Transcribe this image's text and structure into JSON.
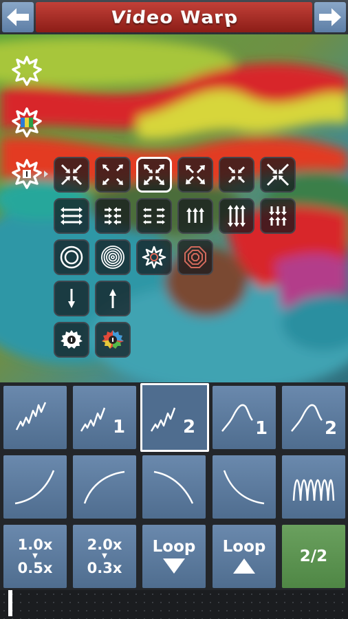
{
  "header": {
    "title": "Video Warp",
    "back_icon": "arrow-left-icon",
    "forward_icon": "arrow-right-icon"
  },
  "side_tools": [
    {
      "name": "warp-mode-icon",
      "icon": "star-burst-icon"
    },
    {
      "name": "color-mode-icon",
      "icon": "star-burst-color-icon"
    },
    {
      "name": "effect-menu-icon",
      "icon": "star-burst-info-icon"
    }
  ],
  "effects_menu": {
    "rows": [
      [
        "pinch-in-icon",
        "expand-corners-icon",
        "pinch-selected-icon",
        "stretch-out-icon",
        "pinch-small-icon",
        "shrink-center-icon"
      ],
      [
        "horizontal-swipe-icon",
        "horizontal-push-icon",
        "horizontal-split-icon",
        "vertical-swipe-icon",
        "vertical-push-icon",
        "vertical-split-icon"
      ],
      [
        "ripple-ring-icon",
        "ripple-many-icon",
        "burst-star-icon",
        "ripple-octagon-icon"
      ],
      [
        "arrow-down-icon",
        "arrow-up-icon"
      ],
      [
        "settings-gear-icon",
        "color-gear-icon"
      ]
    ],
    "selected": "pinch-selected-icon"
  },
  "curves": {
    "row1": [
      {
        "name": "zigzag-curve",
        "label": ""
      },
      {
        "name": "zigzag-curve-1",
        "label": "1"
      },
      {
        "name": "zigzag-curve-2",
        "label": "2",
        "selected": true
      },
      {
        "name": "smooth-curve-1",
        "label": "1"
      },
      {
        "name": "smooth-curve-2",
        "label": "2"
      }
    ],
    "row2": [
      "ease-in-curve",
      "ease-out-curve",
      "decay-curve",
      "fall-curve",
      "wave-curve"
    ]
  },
  "controls": {
    "speed_1": {
      "top": "1.0x",
      "bottom": "0.5x"
    },
    "speed_2": {
      "top": "2.0x",
      "bottom": "0.3x"
    },
    "loop_down": "Loop",
    "loop_up": "Loop",
    "page": "2/2"
  },
  "colors": {
    "title_red": "#b0322b",
    "nav_blue": "#7393b8",
    "panel_blue": "#5c7b9f",
    "page_green": "#5f9853"
  }
}
